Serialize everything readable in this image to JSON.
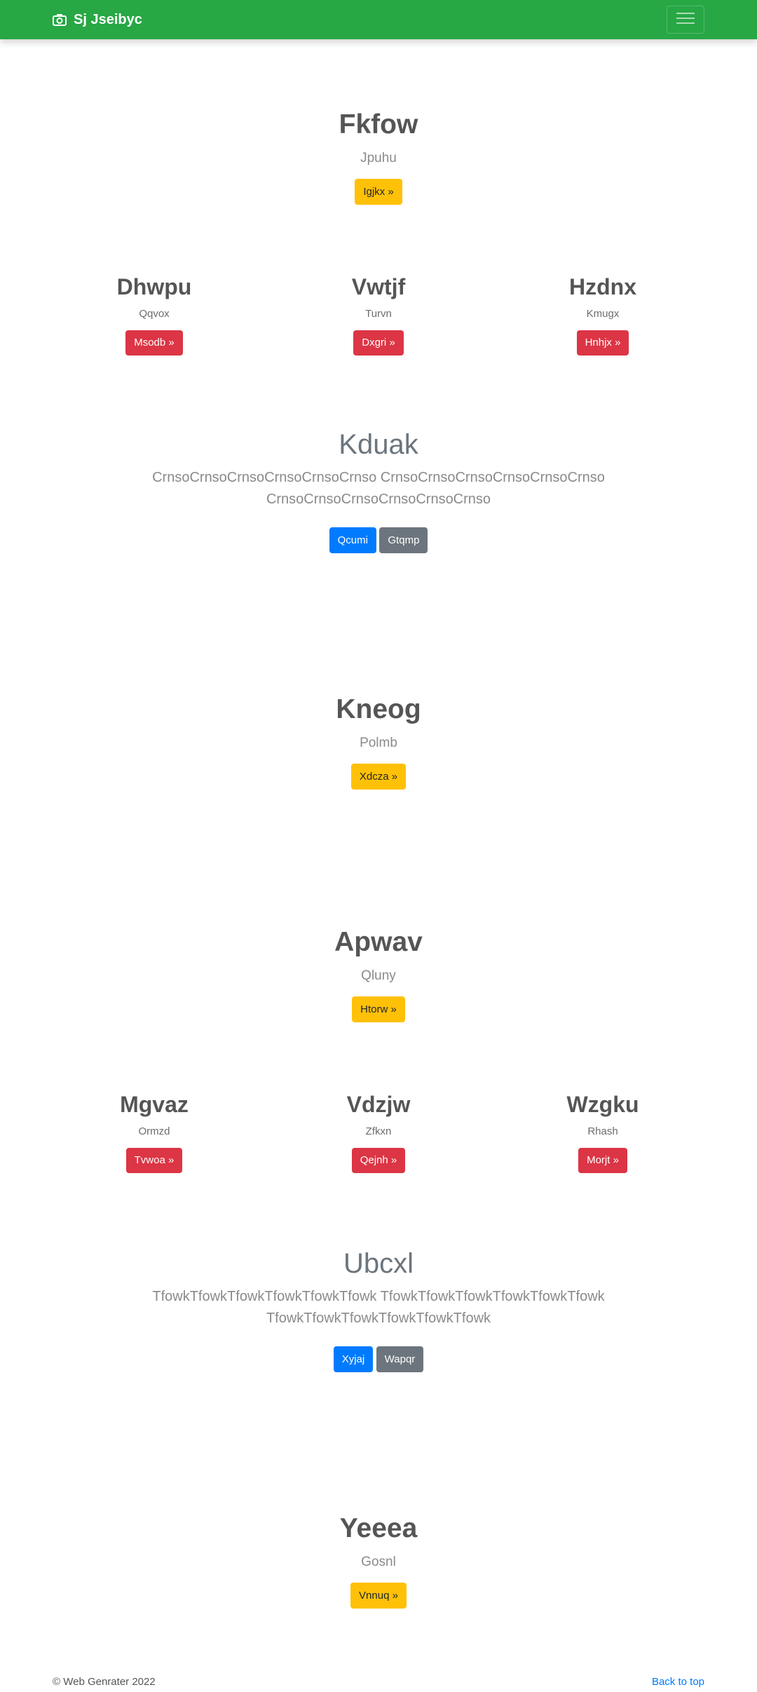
{
  "navbar": {
    "brand": "Sj Jseibyc",
    "brand_icon": "camera-icon",
    "toggler_icon": "hamburger-icon",
    "color": "#28a745"
  },
  "hero1": {
    "title": "Fkfow",
    "subtitle": "Jpuhu",
    "button": "Igjkx »"
  },
  "cols1": [
    {
      "title": "Dhwpu",
      "text": "Qqvox",
      "button": "Msodb »"
    },
    {
      "title": "Vwtjf",
      "text": "Turvn",
      "button": "Dxgri »"
    },
    {
      "title": "Hzdnx",
      "text": "Kmugx",
      "button": "Hnhjx »"
    }
  ],
  "jumbo1": {
    "title": "Kduak",
    "lead_line1": "CrnsoCrnsoCrnsoCrnsoCrnsoCrnso CrnsoCrnsoCrnsoCrnsoCrnsoCrnso",
    "lead_line2": "CrnsoCrnsoCrnsoCrnsoCrnsoCrnso",
    "primary": "Qcumi",
    "secondary": "Gtqmp"
  },
  "hero2": {
    "title": "Kneog",
    "subtitle": "Polmb",
    "button": "Xdcza »"
  },
  "hero3": {
    "title": "Apwav",
    "subtitle": "Qluny",
    "button": "Htorw »"
  },
  "cols2": [
    {
      "title": "Mgvaz",
      "text": "Ormzd",
      "button": "Tvwoa »"
    },
    {
      "title": "Vdzjw",
      "text": "Zfkxn",
      "button": "Qejnh »"
    },
    {
      "title": "Wzgku",
      "text": "Rhash",
      "button": "Morjt »"
    }
  ],
  "jumbo2": {
    "title": "Ubcxl",
    "lead_line1": "TfowkTfowkTfowkTfowkTfowkTfowk TfowkTfowkTfowkTfowkTfowkTfowk",
    "lead_line2": "TfowkTfowkTfowkTfowkTfowkTfowk",
    "primary": "Xyjaj",
    "secondary": "Wapqr"
  },
  "hero4": {
    "title": "Yeeea",
    "subtitle": "Gosnl",
    "button": "Vnnuq »"
  },
  "footer": {
    "copyright": "© Web Genrater 2022",
    "back_to_top": "Back to top"
  }
}
